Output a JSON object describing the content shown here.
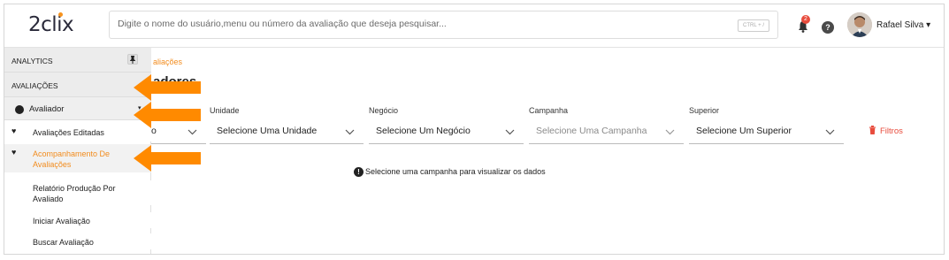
{
  "header": {
    "logo": "2clix",
    "search_placeholder": "Digite o nome do usuário,menu ou número da avaliação que deseja pesquisar...",
    "search_shortcut": "CTRL + /",
    "notification_count": "2",
    "help_label": "?",
    "user_name": "Rafael Silva",
    "user_caret": "▾"
  },
  "sidebar": {
    "analytics": "ANALYTICS",
    "pin": "📌",
    "avaliacoes": "AVALIAÇÕES",
    "avaliador": "Avaliador",
    "avaliador_caret": "▾",
    "items": [
      {
        "label": "Avaliações Editadas"
      },
      {
        "label": "Acompanhamento De Avaliações"
      },
      {
        "label": "Relatório Produção Por Avaliado"
      },
      {
        "label": "Iniciar Avaliação"
      },
      {
        "label": "Buscar Avaliação"
      }
    ]
  },
  "main": {
    "breadcrumb": "aliações",
    "title": "adores",
    "filters": [
      {
        "label": "",
        "value": "o"
      },
      {
        "label": "Unidade",
        "value": "Selecione Uma Unidade"
      },
      {
        "label": "Negócio",
        "value": "Selecione Um Negócio"
      },
      {
        "label": "Campanha",
        "value": "Selecione Uma Campanha"
      },
      {
        "label": "Superior",
        "value": "Selecione Um Superior"
      }
    ],
    "filtros_label": "Filtros",
    "info_message": "Selecione uma campanha para visualizar os dados"
  },
  "colors": {
    "accent": "#f28c1e",
    "arrow": "#ff8a00",
    "danger": "#e84c3d"
  }
}
